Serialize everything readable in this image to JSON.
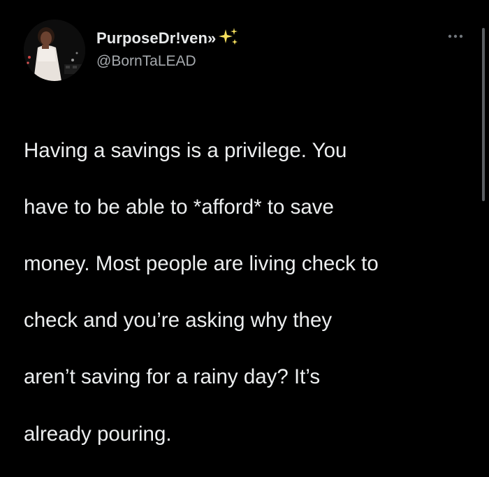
{
  "tweet": {
    "author": {
      "display_name": "PurposeDr!ven»",
      "handle": "@BornTaLEAD",
      "avatar_icon": "profile-photo",
      "name_emoji_icon": "sparkles-icon"
    },
    "more_icon": "more-options-icon",
    "text_lines": [
      "Having a savings is a privilege. You",
      "have to be able to *afford* to save",
      "money. Most people are living check to",
      "check and you’re asking why they",
      "aren’t saving for a rainy day? It’s",
      "already pouring."
    ]
  },
  "colors": {
    "background": "#000000",
    "primary_text": "#e7e9ea",
    "secondary_text": "#a6aaae",
    "sparkle": "#f6e05e"
  }
}
